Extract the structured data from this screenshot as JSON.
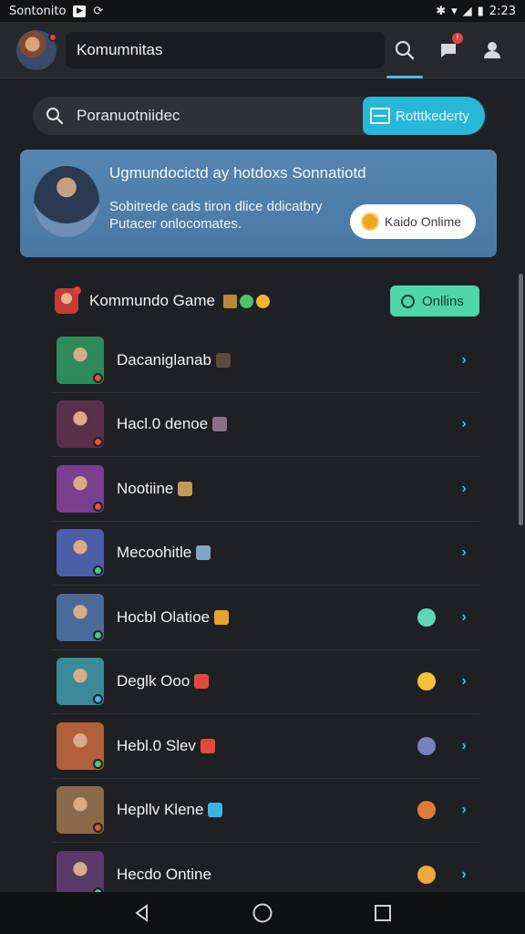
{
  "status_bar": {
    "carrier": "Sontonito",
    "time": "2:23"
  },
  "app_bar": {
    "title": "Komumnitas"
  },
  "search": {
    "query": "Poranuotniidec",
    "button_label": "Rotttkederty"
  },
  "banner": {
    "title": "Ugmundocictd ay hotdoxs Sonnatiotd",
    "description": "Sobitrede cads tiron dlice ddicatbry Putacer onlocomates.",
    "button_label": "Kaido Onlime"
  },
  "list_header": {
    "title": "Kommundo Game",
    "online_label": "Onllins"
  },
  "rows": [
    {
      "label": "Dacaniglanab",
      "thumb": "#2f8a5a",
      "mini": "#e0553c",
      "emo": "#5e4b3a",
      "status": null
    },
    {
      "label": "Hacl.0 denoe",
      "thumb": "#5a2f4a",
      "mini": "#e0553c",
      "emo": "#8b6f86",
      "status": null
    },
    {
      "label": "Nootiine",
      "thumb": "#7a3f8f",
      "mini": "#e0553c",
      "emo": "#c49a5a",
      "status": null
    },
    {
      "label": "Mecoohitle",
      "thumb": "#4a5fa8",
      "mini": "#48c78a",
      "emo": "#7ea6c9",
      "status": null
    },
    {
      "label": "Hocbl Olatioe",
      "thumb": "#4a6a9a",
      "mini": "#48c78a",
      "emo": "#e8a32e",
      "status": "#5fd7b6"
    },
    {
      "label": "Deglk Ooo",
      "thumb": "#3a8a9a",
      "mini": "#3cb3e6",
      "emo": "#e04a3a",
      "status": "#f2c23a"
    },
    {
      "label": "Hebl.0 Slev",
      "thumb": "#b0603a",
      "mini": "#48c78a",
      "emo": "#e04a3a",
      "status": "#7a7fc0"
    },
    {
      "label": "Hepllv Klene",
      "thumb": "#8a6a4a",
      "mini": "#e0553c",
      "emo": "#3cb3e6",
      "status": "#e07a3a"
    },
    {
      "label": "Hecdo Ontine",
      "thumb": "#5a3a6a",
      "mini": "#48c78a",
      "emo": null,
      "status": "#f0a83a"
    }
  ]
}
